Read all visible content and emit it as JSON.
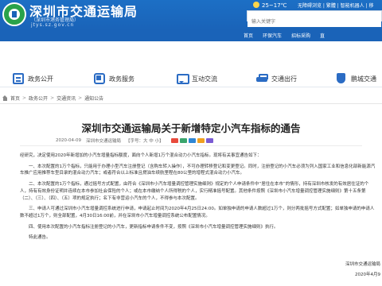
{
  "header": {
    "site_title": "深圳市交通运输局",
    "site_subtitle": "（深圳市港务管理局）",
    "site_url": "jtys.sz.gov.cn",
    "weather": "25~17℃",
    "top_links": "无障碍浏览 | 繁體 | 智能机器人 | 移",
    "search_placeholder": "输入关键字"
  },
  "menubar": {
    "items": [
      "首页",
      "环保汽车",
      "招标采购",
      "直"
    ]
  },
  "tabs": [
    {
      "label": "政务公开",
      "icon": "document-icon"
    },
    {
      "label": "政务服务",
      "icon": "service-icon"
    },
    {
      "label": "互动交流",
      "icon": "chat-icon"
    },
    {
      "label": "交通出行",
      "icon": "car-icon"
    },
    {
      "label": "鹏城交通",
      "icon": "shield-icon"
    }
  ],
  "breadcrumb": {
    "items": [
      "首页",
      "政务公开",
      "交通资讯",
      "通知公告"
    ]
  },
  "article": {
    "title": "深圳市交通运输局关于新增特定小汽车指标的通告",
    "date": "2020-04-09",
    "source": "深圳市交通运输局",
    "font_size_label": "【字号：大 中 小】",
    "share_colors": [
      "#e84a3c",
      "#3aa56d",
      "#2f86d4",
      "#f0a020",
      "#7a5bd3"
    ],
    "paragraphs": [
      {
        "text": "经研究，决定使用2020年新增加的小汽车增量指标额度，面向个人新增1万个混合动力小汽车指标。现将有关事宜通告如下：",
        "indent": true
      },
      {
        "text": "一、本次配置的1万个指标，只能用于办理小型汽车注册登记（含购车转入操作），不可办理转移登记和变更登记。同时，注册登记的小汽车必须为列入国家工业和信息化部新能源汽车推广应用推荐车型目录的混合动力汽车；或者符合以上标准且燃油车续航里程在80公里的增程式混合动力小汽车。",
        "indent": true
      },
      {
        "text": "二、本次配置的1万个指标，通过摇号方式配置，由符合《深圳市小汽车增量调控管理实施细则》规定的个人申请条件中“居住在本市”的情形，持有深圳市核发的有效居住证的个人，持有有效身份证明并连续在本市参加社会保险的个人；或在本市缴纳个人所得税的个人，实行精准摇号配置。其他条件按照《深圳市小汽车增量调控管理实施细则》第十五条第（二）、（三）、（四）、（五）项的规定执行；名下有非营运小汽车的个人，不得参与本次配置。",
        "indent": true
      },
      {
        "text": "三、申请人可通过深圳市小汽车增量调控系统进行申请，申请起止时间为2020年4月25日24:00。如单独申请的申请人数超过1万个，则分两批摇号方式配置；如单独申请的申请人数不超过1万个，则全部配置，4月30日16:00前，并在深圳市小汽车增量调控系统公布配置情况。",
        "indent": true
      },
      {
        "text": "四、使用本次配置的小汽车指标注册登记的小汽车，更新指标申请条件不变，按照《深圳市小汽车增量调控管理实施细则》执行。",
        "indent": true
      },
      {
        "text": "特此通告。",
        "indent": true
      }
    ],
    "signature": "深圳市交通运输局",
    "signature_date": "2020年4月9"
  }
}
